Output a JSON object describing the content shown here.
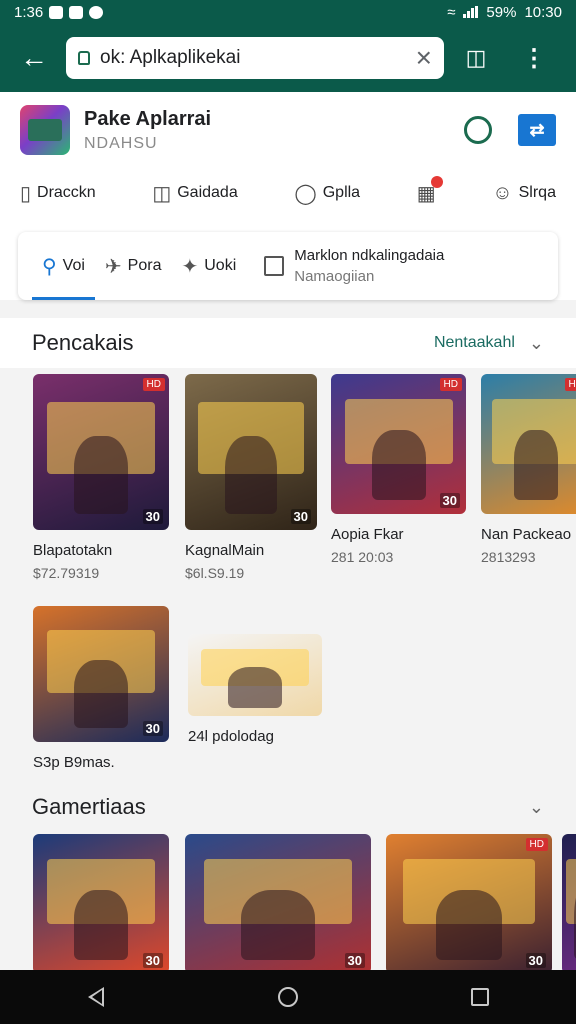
{
  "status_bar": {
    "time_left": "1:36",
    "battery": "59%",
    "time_right": "10:30"
  },
  "url_bar": {
    "text": "ok: Aplkaplikekai"
  },
  "app_header": {
    "title": "Pake Aplarrai",
    "subtitle": "NDAHSU"
  },
  "nav": [
    {
      "label": "Dracckn",
      "icon": "phone-icon"
    },
    {
      "label": "Gaidada",
      "icon": "tag-icon"
    },
    {
      "label": "Gplla",
      "icon": "chat-icon"
    },
    {
      "label": "",
      "icon": "map-icon"
    },
    {
      "label": "Slrqa",
      "icon": "person-icon"
    }
  ],
  "tabs": [
    {
      "label": "Voi",
      "icon": "search-icon"
    },
    {
      "label": "Pora",
      "icon": "plane-icon"
    },
    {
      "label": "Uoki",
      "icon": "tools-icon"
    }
  ],
  "filter": {
    "line1": "Marklon ndkalingadaia",
    "line2": "Namaogiian"
  },
  "section1": {
    "title": "Pencakais",
    "more": "Nentaakahl",
    "cards": [
      {
        "name": "Blapatotakn",
        "price": "$72.79319",
        "badge": "30",
        "tag": "HD",
        "c1": "#7a2f6b",
        "c2": "#1e1a3a"
      },
      {
        "name": "KagnalMain",
        "price": "$6l.S9.19",
        "badge": "30",
        "tag": "",
        "c1": "#7d6a4a",
        "c2": "#2f2418"
      },
      {
        "name": "Aopia Fkar",
        "price": "281 20:03",
        "badge": "30",
        "tag": "HD",
        "c1": "#3d3a8f",
        "c2": "#b12f3a"
      },
      {
        "name": "Nan Packeao",
        "price": "2813293",
        "badge": "",
        "tag": "HD",
        "c1": "#2c7ea8",
        "c2": "#e08a2a"
      },
      {
        "name": "S3p B9mas.",
        "price": "",
        "badge": "30",
        "tag": "",
        "c1": "#d6722a",
        "c2": "#1b2a5a"
      },
      {
        "name": "24l pdolodag",
        "price": "",
        "badge": "",
        "tag": "",
        "c1": "#f4f4f4",
        "c2": "#f0d8a8"
      }
    ]
  },
  "section2": {
    "title": "Gamertiaas",
    "cards": [
      {
        "badge": "30",
        "tag": "",
        "c1": "#1c3b7a",
        "c2": "#e0482a"
      },
      {
        "badge": "30",
        "tag": "",
        "c1": "#2a4a8a",
        "c2": "#b03030"
      },
      {
        "badge": "30",
        "tag": "HD",
        "c1": "#e08030",
        "c2": "#3a2030"
      },
      {
        "badge": "",
        "tag": "",
        "c1": "#202050",
        "c2": "#6a2a80"
      }
    ]
  }
}
